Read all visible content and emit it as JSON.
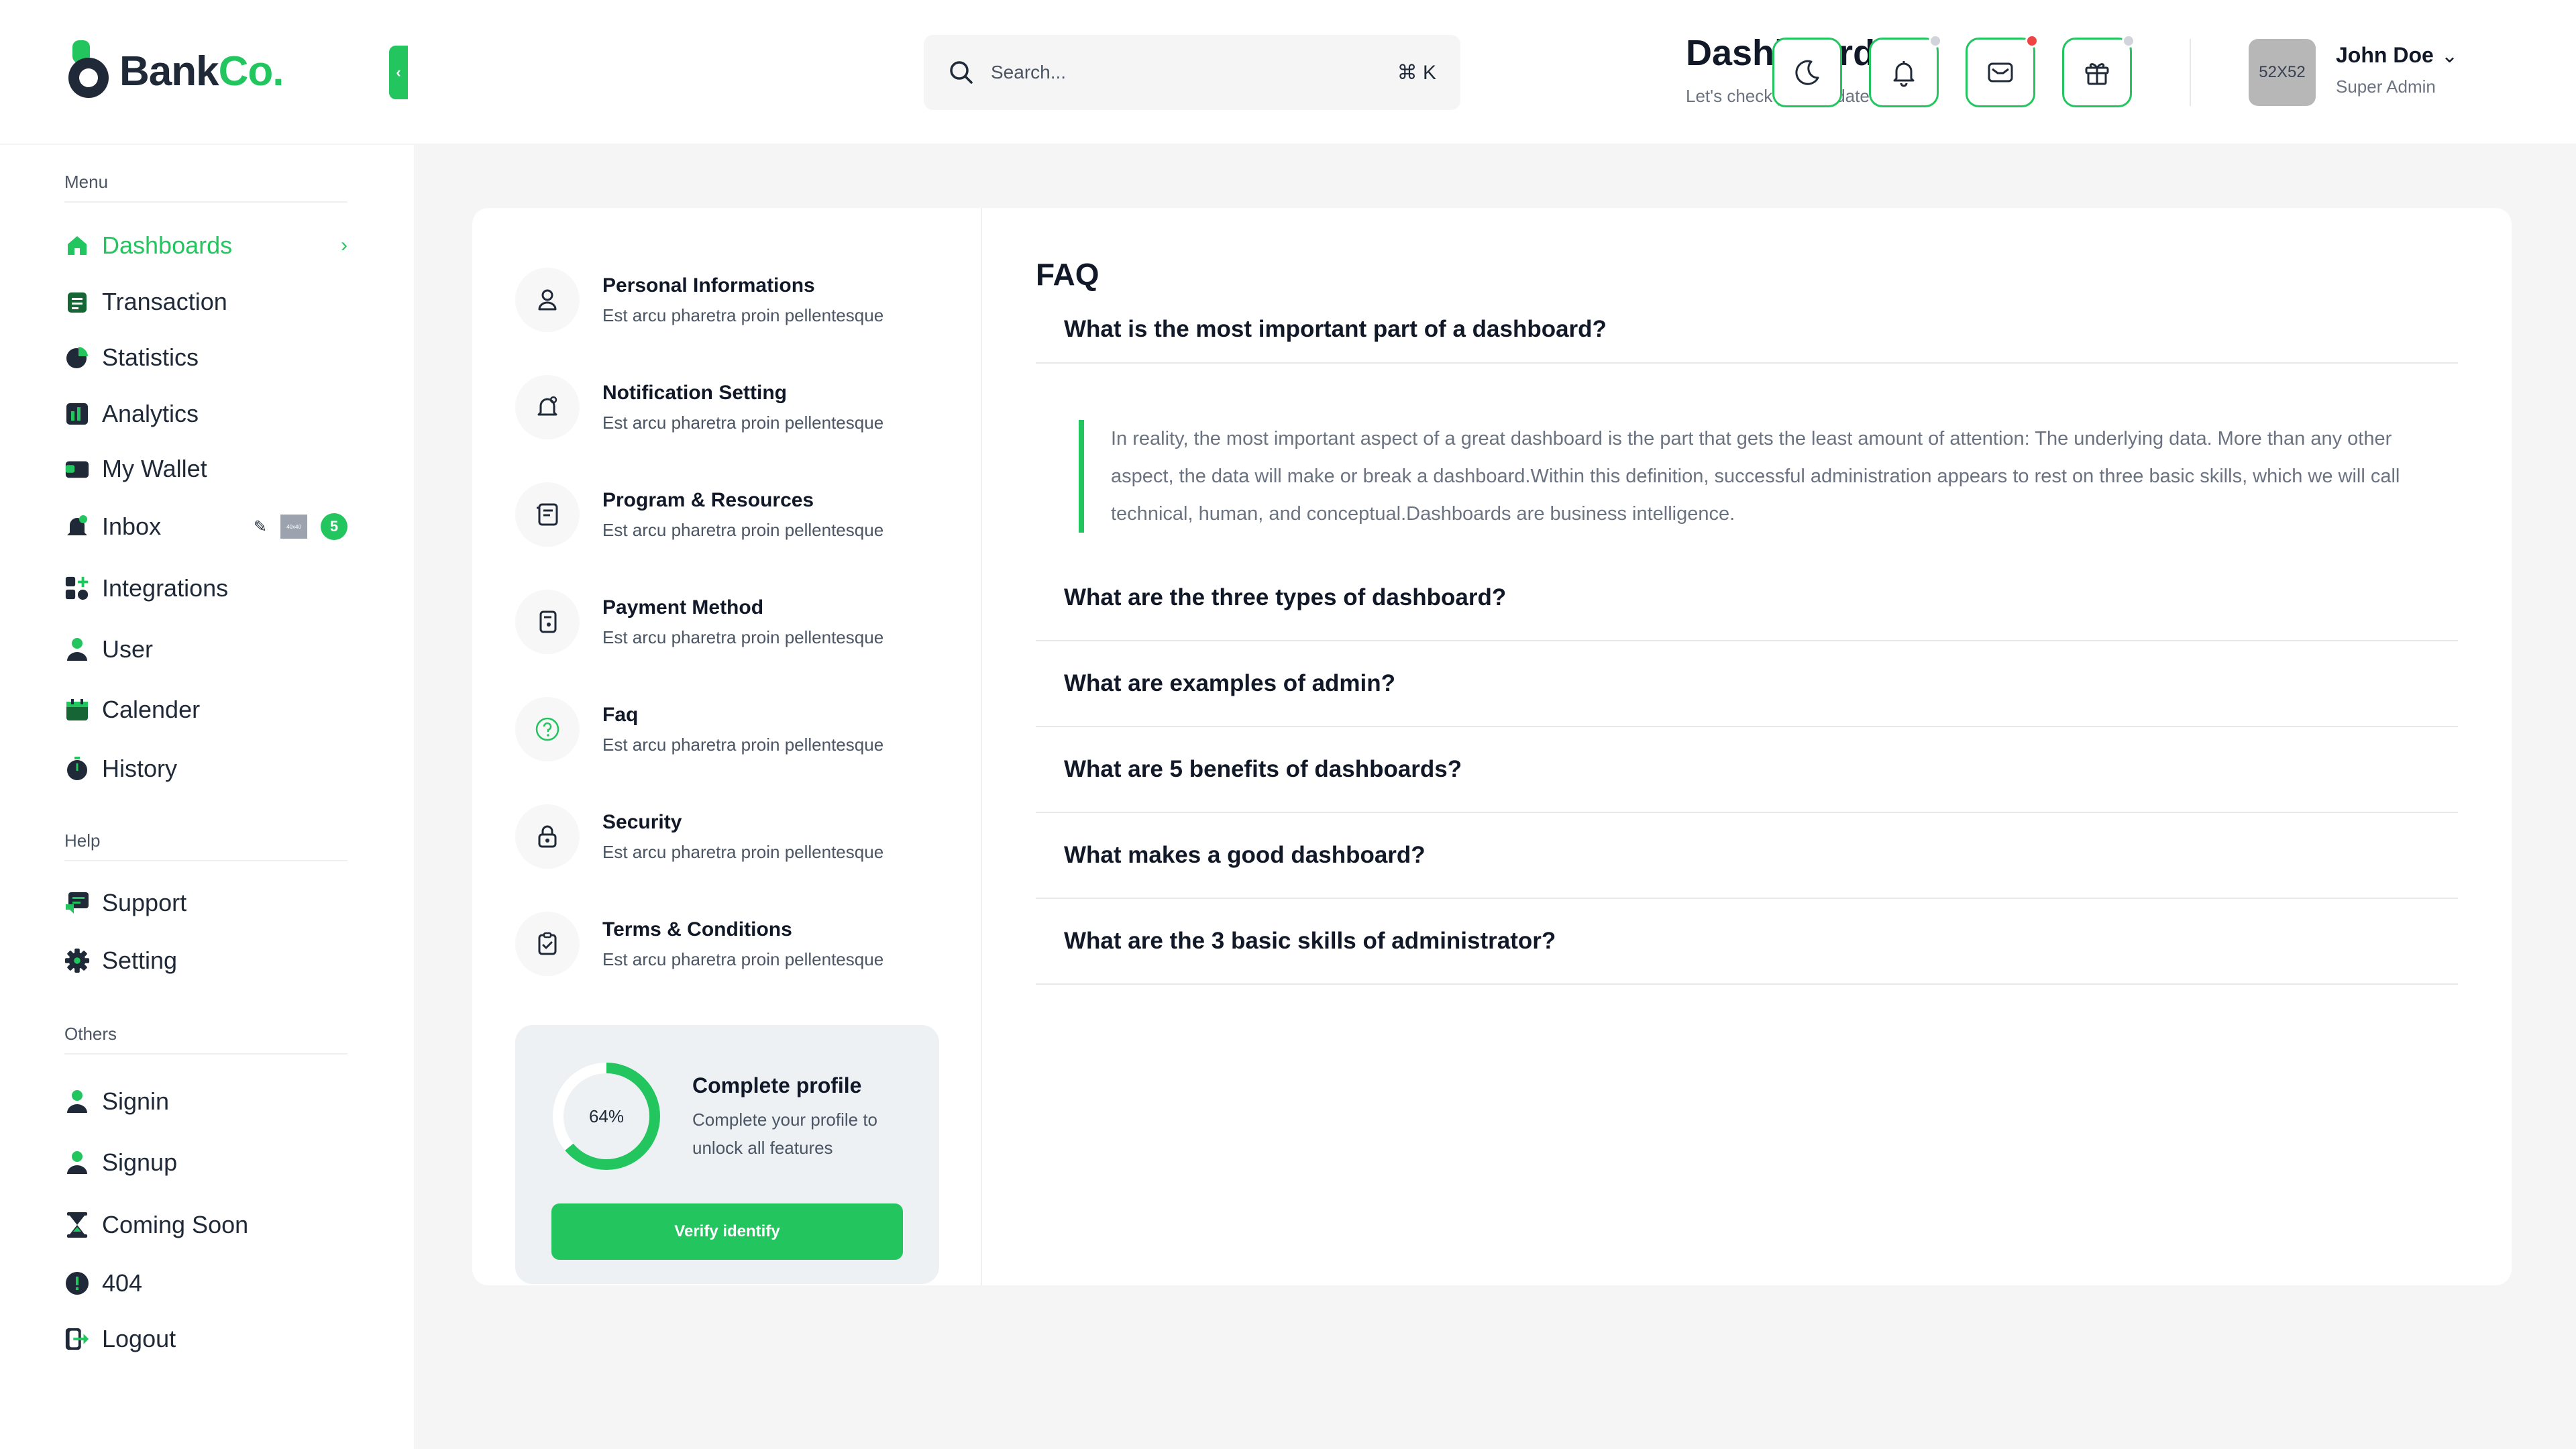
{
  "brand": {
    "name_part1": "Bank",
    "name_part2": "Co.",
    "accent": "#22c55e"
  },
  "sidebar": {
    "collapse_glyph": "‹",
    "menu_label": "Menu",
    "help_label": "Help",
    "others_label": "Others",
    "menu_items": [
      {
        "label": "Dashboards",
        "icon": "home-icon",
        "active": true
      },
      {
        "label": "Transaction",
        "icon": "clipboard-icon"
      },
      {
        "label": "Statistics",
        "icon": "pie-chart-icon"
      },
      {
        "label": "Analytics",
        "icon": "bar-chart-icon"
      },
      {
        "label": "My Wallet",
        "icon": "wallet-icon"
      },
      {
        "label": "Inbox",
        "icon": "bell-icon",
        "badge": "5",
        "thumb": "40x40"
      },
      {
        "label": "Integrations",
        "icon": "grid-plus-icon"
      },
      {
        "label": "User",
        "icon": "user-icon"
      },
      {
        "label": "Calender",
        "icon": "calendar-icon"
      },
      {
        "label": "History",
        "icon": "stopwatch-icon"
      }
    ],
    "help_items": [
      {
        "label": "Support",
        "icon": "chat-icon"
      },
      {
        "label": "Setting",
        "icon": "gear-icon"
      }
    ],
    "other_items": [
      {
        "label": "Signin",
        "icon": "user-icon"
      },
      {
        "label": "Signup",
        "icon": "user-icon"
      },
      {
        "label": "Coming Soon",
        "icon": "hourglass-icon"
      },
      {
        "label": "404",
        "icon": "alert-icon"
      },
      {
        "label": "Logout",
        "icon": "logout-icon"
      }
    ]
  },
  "header": {
    "search_placeholder": "Search...",
    "search_shortcut": "⌘ K",
    "title": "Dashboard",
    "subtitle": "Let's check your update today",
    "buttons": [
      {
        "name": "theme-toggle-button",
        "icon": "moon-icon"
      },
      {
        "name": "notifications-button",
        "icon": "bell-icon",
        "dot": "#d1d5db"
      },
      {
        "name": "messages-button",
        "icon": "mail-icon",
        "dot": "#ef4444"
      },
      {
        "name": "gifts-button",
        "icon": "gift-icon",
        "dot": "#d1d5db"
      }
    ],
    "avatar_text": "52X52",
    "user_name": "John Doe",
    "user_role": "Super Admin"
  },
  "settings": {
    "items": [
      {
        "title": "Personal Informations",
        "desc": "Est arcu pharetra proin pellentesque",
        "icon": "user-outline-icon"
      },
      {
        "title": "Notification Setting",
        "desc": "Est arcu pharetra proin pellentesque",
        "icon": "bell-outline-icon"
      },
      {
        "title": "Program & Resources",
        "desc": "Est arcu pharetra proin pellentesque",
        "icon": "document-icon"
      },
      {
        "title": "Payment Method",
        "desc": "Est arcu pharetra proin pellentesque",
        "icon": "wallet-outline-icon"
      },
      {
        "title": "Faq",
        "desc": "Est arcu pharetra proin pellentesque",
        "icon": "question-icon",
        "active": true
      },
      {
        "title": "Security",
        "desc": "Est arcu pharetra proin pellentesque",
        "icon": "lock-icon"
      },
      {
        "title": "Terms & Conditions",
        "desc": "Est arcu pharetra proin pellentesque",
        "icon": "clipboard-check-icon"
      }
    ]
  },
  "profile": {
    "progress": 0.64,
    "progress_label": "64%",
    "title": "Complete profile",
    "desc": "Complete your profile to unlock all features",
    "button": "Verify identify"
  },
  "faq": {
    "heading": "FAQ",
    "open_question": "What is the most important part of a dashboard?",
    "answer": "In reality, the most important aspect of a great dashboard is the part that gets the least amount of attention: The underlying data. More than any other aspect, the data will make or break a dashboard.Within this definition, successful administration appears to rest on three basic skills, which we will call technical, human, and conceptual.Dashboards are business intelligence.",
    "questions": [
      "What are the three types of dashboard?",
      "What are examples of admin?",
      "What are 5 benefits of dashboards?",
      "What makes a good dashboard?",
      "What are the 3 basic skills of administrator?"
    ]
  }
}
